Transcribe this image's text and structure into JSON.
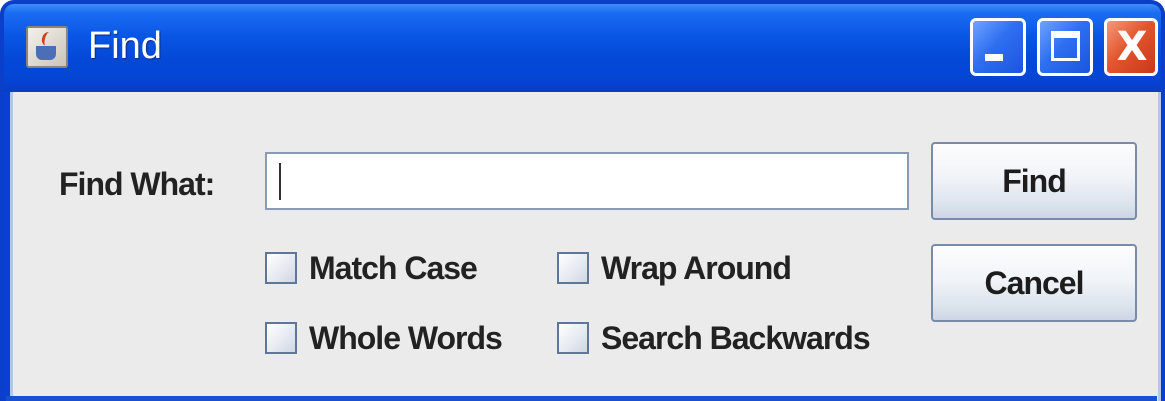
{
  "window": {
    "title": "Find",
    "icon": "java-cup-icon",
    "controls": {
      "minimize": "minimize-icon",
      "maximize": "maximize-icon",
      "close_glyph": "X"
    }
  },
  "form": {
    "find_label": "Find What:",
    "find_value": "",
    "find_placeholder": ""
  },
  "options": {
    "match_case": {
      "label": "Match Case",
      "checked": false
    },
    "wrap_around": {
      "label": "Wrap Around",
      "checked": false
    },
    "whole_words": {
      "label": "Whole Words",
      "checked": false
    },
    "search_backwards": {
      "label": "Search Backwards",
      "checked": false
    }
  },
  "buttons": {
    "find": "Find",
    "cancel": "Cancel"
  },
  "colors": {
    "titlebar": "#0549d8",
    "client_bg": "#ebebeb",
    "close_button": "#e2562e"
  }
}
